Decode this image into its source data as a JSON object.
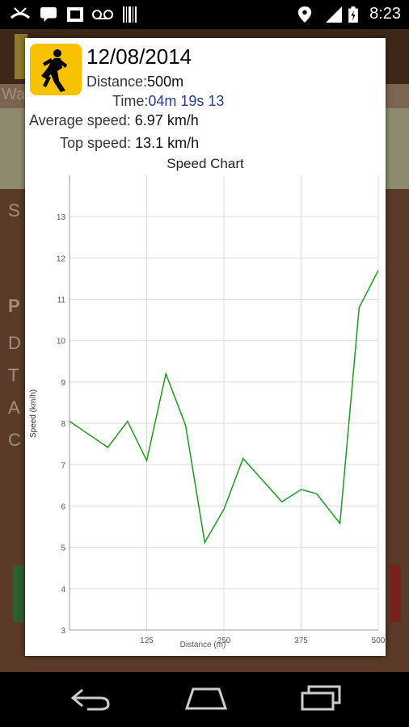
{
  "status_bar": {
    "time": "8:23",
    "icons": [
      "missed-call-icon",
      "chat-icon",
      "sim-icon",
      "voicemail-icon",
      "barcode-icon",
      "location-icon",
      "signal-icon",
      "battery-icon"
    ]
  },
  "background": {
    "row_letters": [
      "Wa",
      "S",
      "P",
      "D",
      "T",
      "A",
      "C"
    ],
    "date_partial": "12/08/2014"
  },
  "dialog": {
    "date": "12/08/2014",
    "distance_label": "Distance:",
    "distance_value": "500m",
    "time_label": "Time:",
    "time_value": "04m 19s 13",
    "avg_label": "Average speed:",
    "avg_value": "6.97 km/h",
    "top_label": "Top speed:",
    "top_value": "13.1 km/h"
  },
  "colors": {
    "accent_yellow": "#f7c300",
    "line_green": "#1f9a1f",
    "time_blue": "#2a3a8a"
  },
  "chart_data": {
    "type": "line",
    "title": "Speed Chart",
    "xlabel": "Distance (m)",
    "ylabel": "Speed (km/h)",
    "xlim": [
      0,
      500
    ],
    "ylim": [
      3,
      14
    ],
    "x_ticks": [
      125,
      250,
      375,
      500
    ],
    "y_ticks": [
      3,
      4,
      5,
      6,
      7,
      8,
      9,
      10,
      11,
      12,
      13
    ],
    "grid": true,
    "series": [
      {
        "x": [
          0,
          62,
          94,
          125,
          156,
          188,
          219,
          250,
          281,
          344,
          375,
          400,
          438,
          469,
          500
        ],
        "y": [
          8.05,
          7.42,
          8.05,
          7.1,
          9.2,
          7.95,
          5.12,
          5.92,
          7.15,
          6.1,
          6.4,
          6.3,
          5.58,
          10.8,
          11.7
        ]
      }
    ]
  }
}
